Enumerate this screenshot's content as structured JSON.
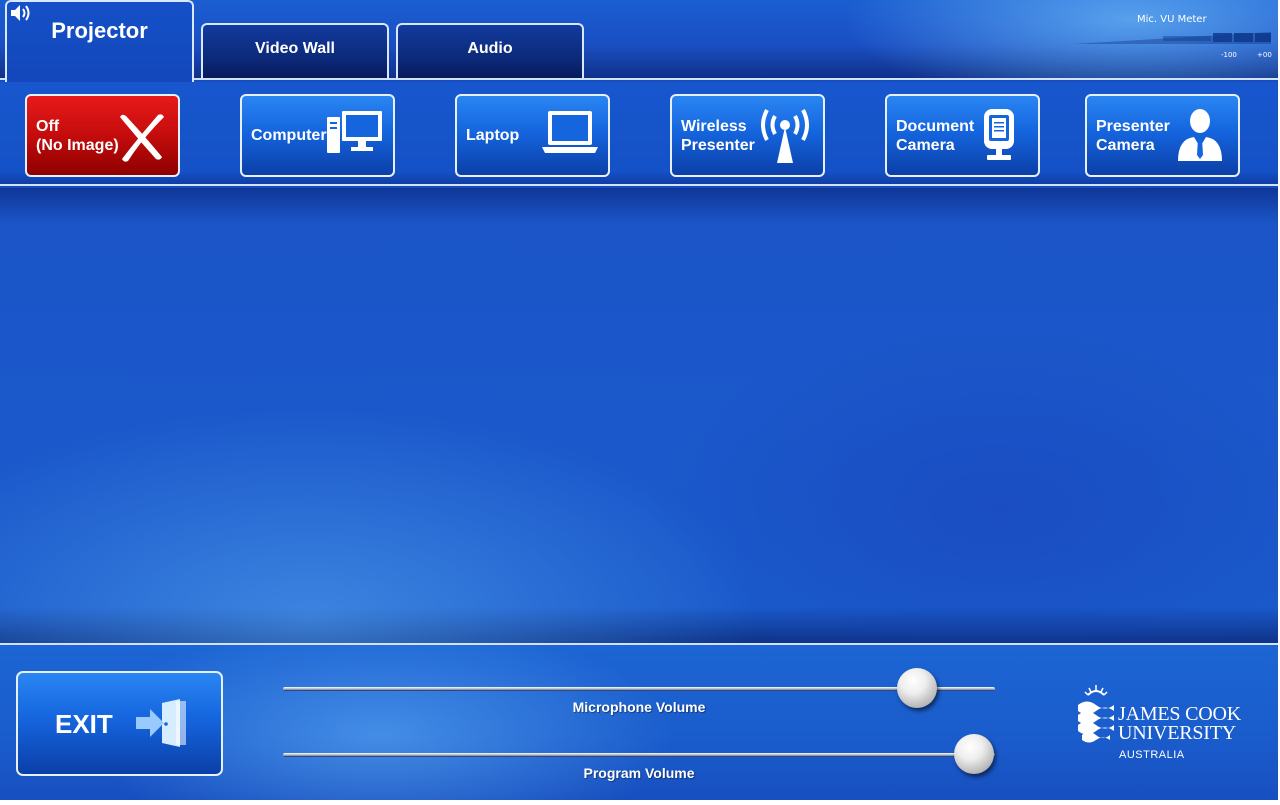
{
  "header": {
    "tabs": [
      {
        "label": "Projector",
        "active": true
      },
      {
        "label": "Video Wall",
        "active": false
      },
      {
        "label": "Audio",
        "active": false
      }
    ],
    "speaker_icon": "speaker-icon"
  },
  "vu_meter": {
    "label": "Mic. VU Meter",
    "min_label": "-100",
    "max_label": "+00"
  },
  "sources": [
    {
      "line1": "Off",
      "line2": "(No Image)",
      "icon": "x-icon",
      "color": "#c40c0c"
    },
    {
      "line1": "Computer",
      "line2": "",
      "icon": "desktop-computer-icon",
      "color": "#1565de"
    },
    {
      "line1": "Laptop",
      "line2": "",
      "icon": "laptop-icon",
      "color": "#1565de"
    },
    {
      "line1": "Wireless",
      "line2": "Presenter",
      "icon": "wireless-antenna-icon",
      "color": "#1565de"
    },
    {
      "line1": "Document",
      "line2": "Camera",
      "icon": "document-camera-icon",
      "color": "#1565de"
    },
    {
      "line1": "Presenter",
      "line2": "Camera",
      "icon": "presenter-person-icon",
      "color": "#1565de"
    }
  ],
  "footer": {
    "exit_label": "EXIT",
    "exit_icon": "exit-door-icon",
    "microphone": {
      "label": "Microphone Volume",
      "level": 0.89
    },
    "program": {
      "label": "Program Volume",
      "level": 0.97
    },
    "logo": {
      "line1": "JAMES COOK",
      "line2": "UNIVERSITY",
      "line3": "AUSTRALIA"
    }
  }
}
